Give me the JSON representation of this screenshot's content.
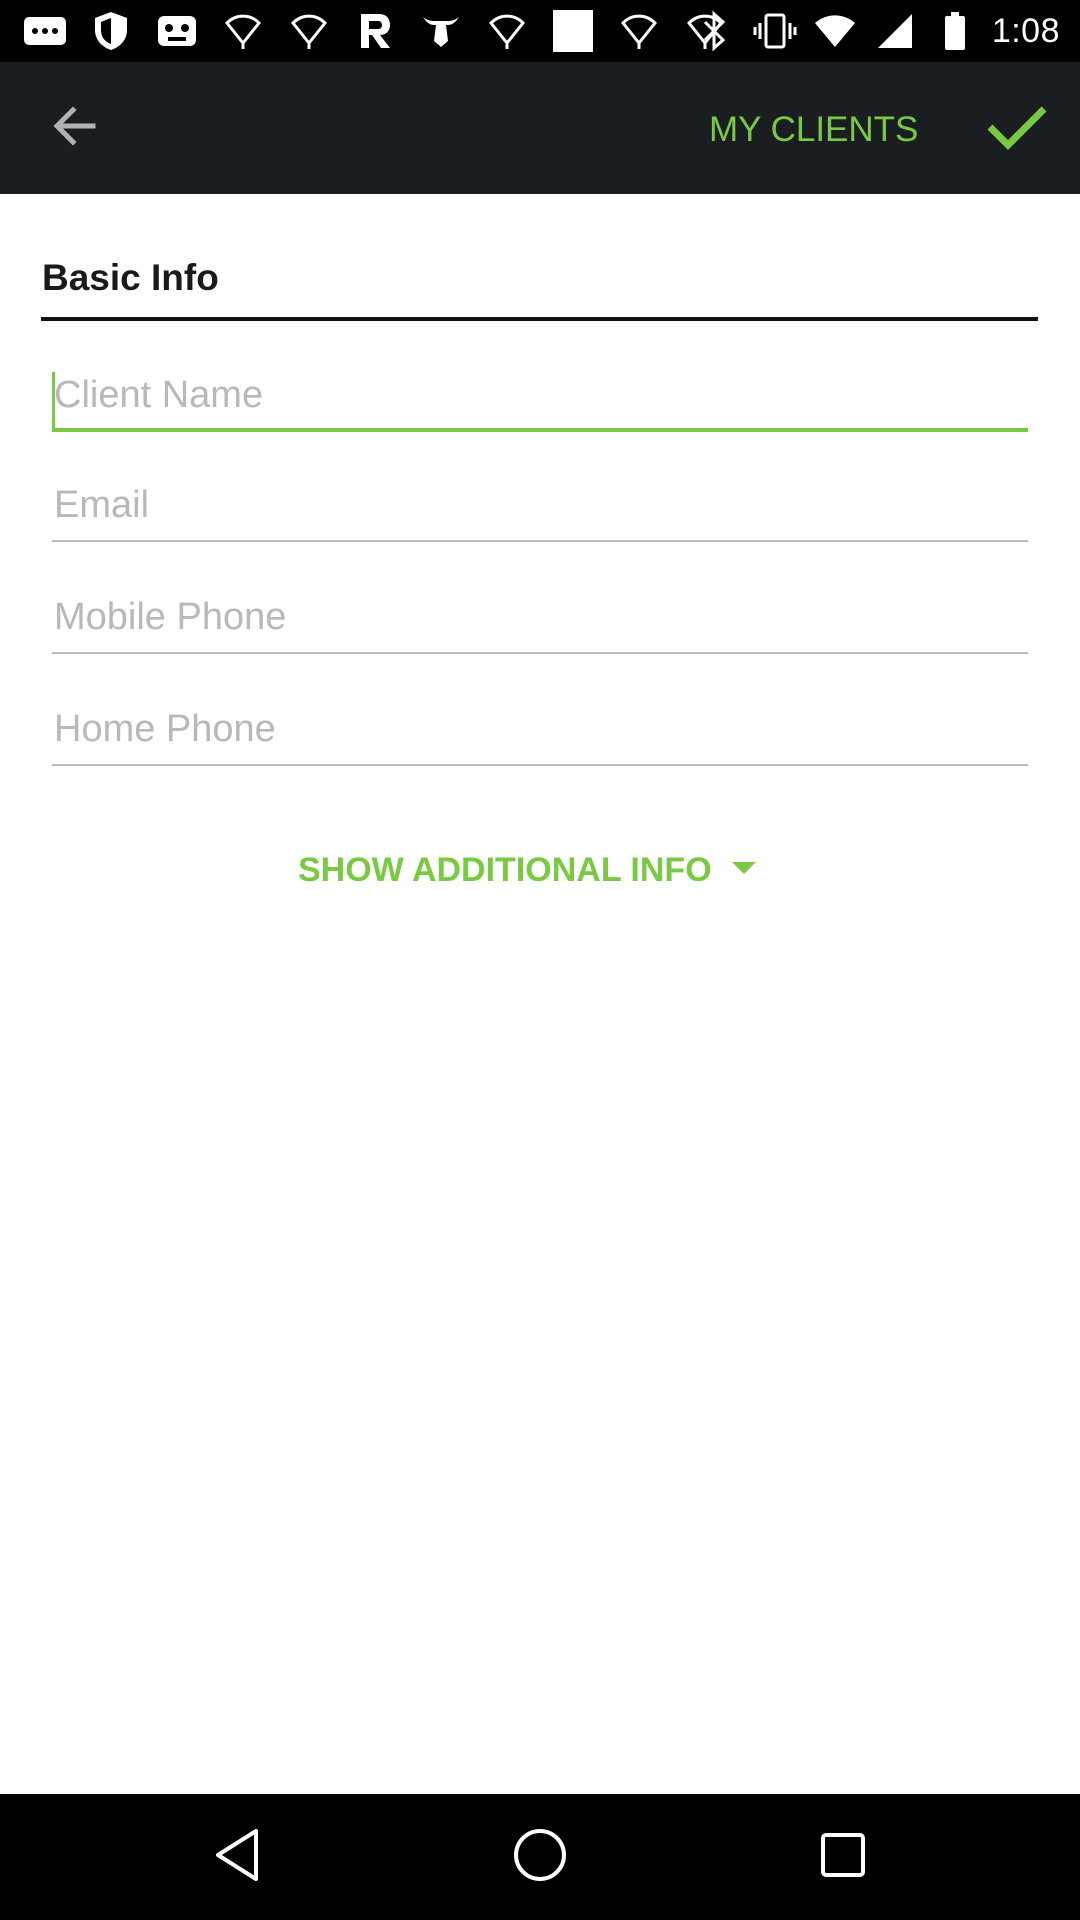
{
  "status_bar": {
    "time": "1:08",
    "left_icons": [
      "more-icon",
      "shield-icon",
      "game-icon",
      "wifi-icon",
      "wifi-icon",
      "r-app-icon",
      "bull-icon",
      "wifi-icon",
      "blank-app-icon",
      "wifi-icon",
      "wifi-icon"
    ],
    "right_icons": [
      "bluetooth-icon",
      "vibrate-icon",
      "wifi-full-icon",
      "signal-icon",
      "battery-icon"
    ]
  },
  "app_bar": {
    "title": "MY CLIENTS",
    "back_icon": "arrow-left-icon",
    "confirm_icon": "checkmark-icon",
    "accent_color": "#7ac943",
    "background_color": "#1b1e21"
  },
  "form": {
    "section_title": "Basic Info",
    "fields": {
      "client_name": {
        "placeholder": "Client Name",
        "value": "",
        "focused": true
      },
      "email": {
        "placeholder": "Email",
        "value": ""
      },
      "mobile_phone": {
        "placeholder": "Mobile Phone",
        "value": ""
      },
      "home_phone": {
        "placeholder": "Home Phone",
        "value": ""
      }
    },
    "show_more_label": "SHOW ADDITIONAL INFO",
    "show_more_icon": "caret-down-icon"
  },
  "nav_bar": {
    "icons": [
      "back-triangle-icon",
      "home-circle-icon",
      "recents-square-icon"
    ]
  }
}
